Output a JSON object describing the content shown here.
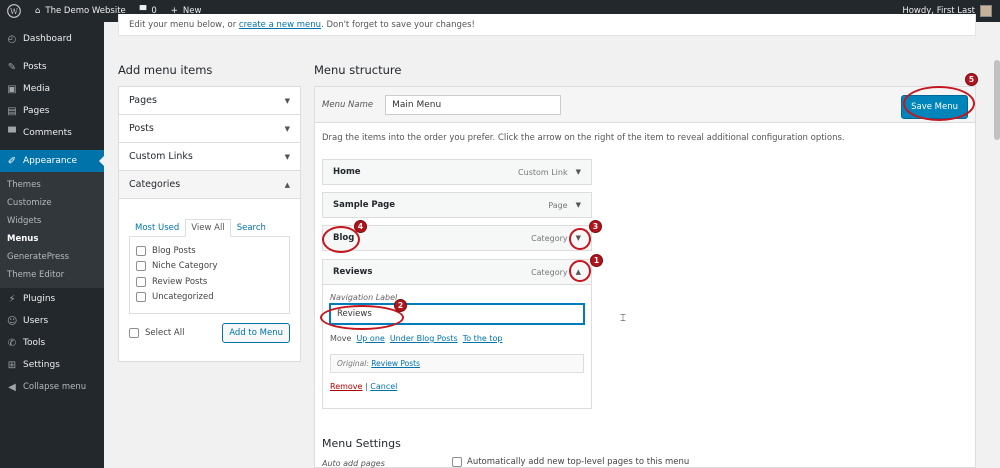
{
  "adminbar": {
    "site_name": "The Demo Website",
    "comments_count": "0",
    "new_label": "New",
    "greeting": "Howdy, First Last"
  },
  "sidebar": {
    "items": [
      {
        "label": "Dashboard",
        "icon": "dashboard-icon"
      },
      {
        "label": "Posts",
        "icon": "pin-icon"
      },
      {
        "label": "Media",
        "icon": "media-icon"
      },
      {
        "label": "Pages",
        "icon": "page-icon"
      },
      {
        "label": "Comments",
        "icon": "comment-icon"
      },
      {
        "label": "Appearance",
        "icon": "brush-icon"
      }
    ],
    "appearance_sub": [
      "Themes",
      "Customize",
      "Widgets",
      "Menus",
      "GeneratePress",
      "Theme Editor"
    ],
    "items_after": [
      {
        "label": "Plugins",
        "icon": "plug-icon"
      },
      {
        "label": "Users",
        "icon": "user-icon"
      },
      {
        "label": "Tools",
        "icon": "wrench-icon"
      },
      {
        "label": "Settings",
        "icon": "settings-icon"
      },
      {
        "label": "Collapse menu",
        "icon": "collapse-icon"
      }
    ]
  },
  "notice": {
    "text_before": "Edit your menu below, or ",
    "link": "create a new menu",
    "text_after": ". Don't forget to save your changes!"
  },
  "add_items": {
    "title": "Add menu items",
    "sections": [
      "Pages",
      "Posts",
      "Custom Links",
      "Categories"
    ],
    "tabs": [
      "Most Used",
      "View All",
      "Search"
    ],
    "categories": [
      "Blog Posts",
      "Niche Category",
      "Review Posts",
      "Uncategorized"
    ],
    "select_all": "Select All",
    "add_button": "Add to Menu"
  },
  "structure": {
    "title": "Menu structure",
    "menu_name_label": "Menu Name",
    "menu_name_value": "Main Menu",
    "save_button": "Save Menu",
    "instructions": "Drag the items into the order you prefer. Click the arrow on the right of the item to reveal additional configuration options.",
    "items": [
      {
        "title": "Home",
        "type": "Custom Link"
      },
      {
        "title": "Sample Page",
        "type": "Page"
      },
      {
        "title": "Blog",
        "type": "Category"
      },
      {
        "title": "Reviews",
        "type": "Category"
      }
    ],
    "settings": {
      "nav_label": "Navigation Label",
      "nav_value": "Reviews",
      "move_label": "Move",
      "move_links": [
        "Up one",
        "Under Blog Posts",
        "To the top"
      ],
      "original_label": "Original:",
      "original_link": "Review Posts",
      "remove": "Remove",
      "separator": "|",
      "cancel": "Cancel"
    },
    "menu_settings_title": "Menu Settings",
    "auto_add_label": "Auto add pages",
    "auto_add_option": "Automatically add new top-level pages to this menu"
  },
  "annotations": [
    "1",
    "2",
    "3",
    "4",
    "5"
  ],
  "colors": {
    "accent": "#0073aa",
    "sidebar": "#23282d",
    "annotation": "#c5161d"
  }
}
